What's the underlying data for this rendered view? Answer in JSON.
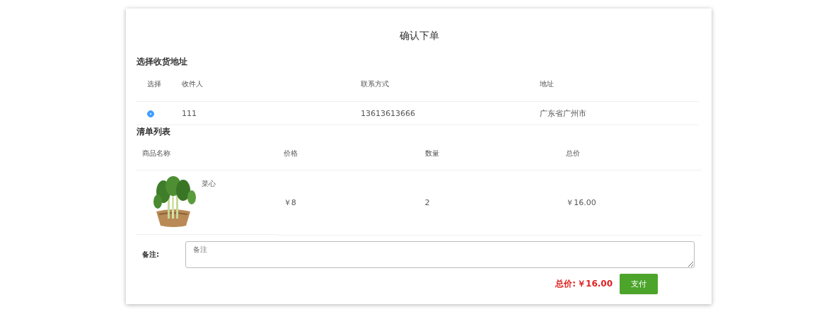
{
  "title": "确认下单",
  "address_section": {
    "heading": "选择收货地址",
    "columns": [
      "选择",
      "收件人",
      "联系方式",
      "地址"
    ],
    "rows": [
      {
        "selected": true,
        "name": "111",
        "phone": "13613613666",
        "address": "广东省广州市"
      }
    ]
  },
  "order_section": {
    "heading": "清单列表",
    "columns": [
      "商品名称",
      "价格",
      "数量",
      "总价"
    ],
    "rows": [
      {
        "name": "菜心",
        "price": "￥8",
        "quantity": "2",
        "total": "￥16.00"
      }
    ]
  },
  "remark": {
    "label": "备注:",
    "placeholder": "备注"
  },
  "total": {
    "label": "总价:",
    "value": "￥16.00"
  },
  "pay_button": "支付"
}
